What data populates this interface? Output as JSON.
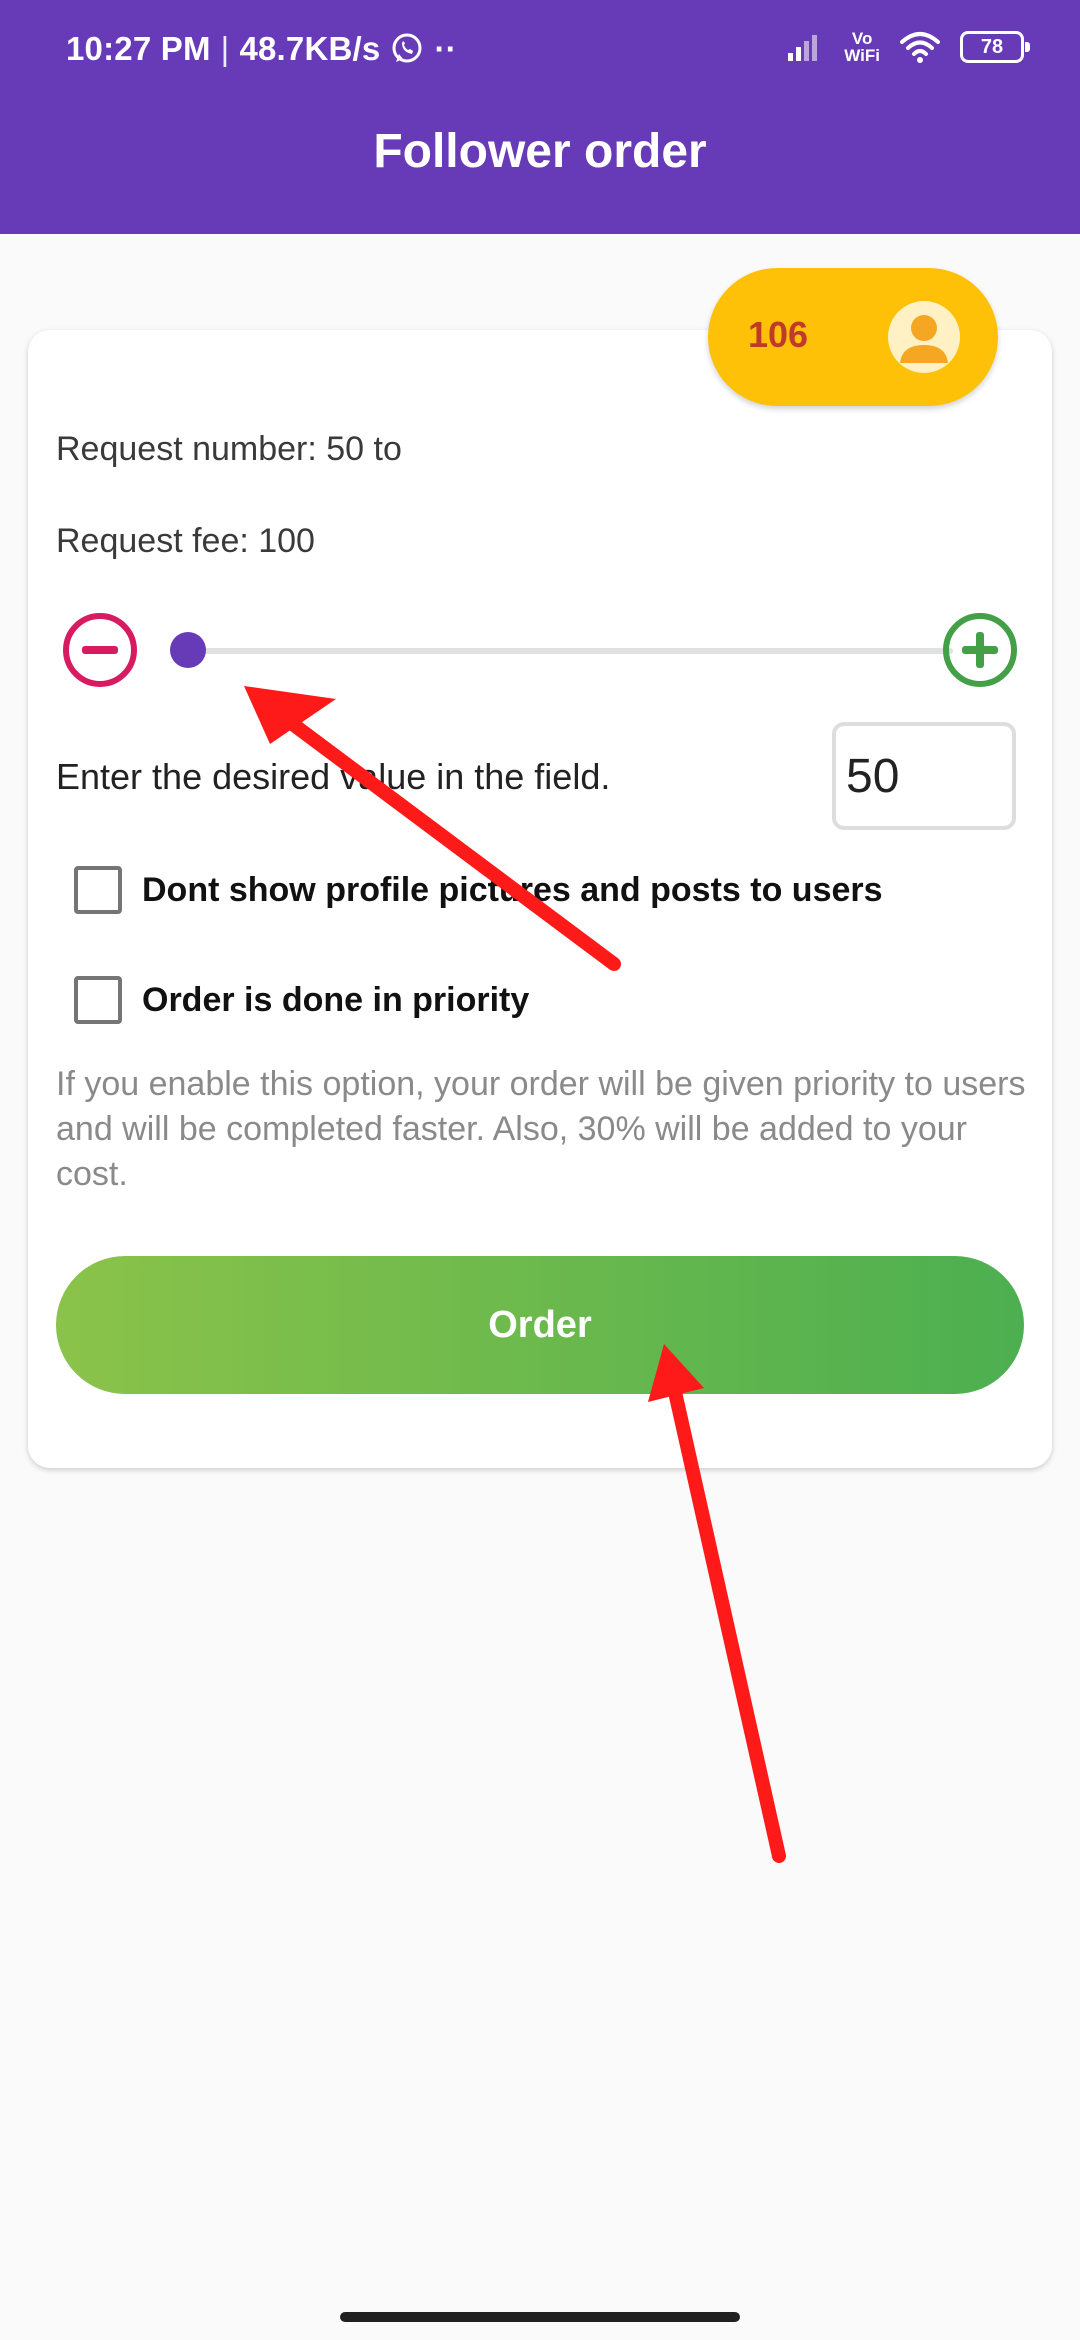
{
  "status_bar": {
    "time": "10:27 PM",
    "separator": "|",
    "speed": "48.7KB/s",
    "dots": "··",
    "vowifi_top": "Vo",
    "vowifi_bottom": "WiFi",
    "battery": "78"
  },
  "app_bar": {
    "title": "Follower order"
  },
  "coins": {
    "count": "106"
  },
  "order_form": {
    "request_number": "Request number: 50 to",
    "request_fee": "Request fee: 100",
    "slider_value": 0,
    "desired_label": "Enter the desired value in the field.",
    "value": "50",
    "option_hide_pictures": "Dont show profile pictures and posts to users",
    "option_priority": "Order is done in priority",
    "priority_hint": "If you enable this option, your order will be given priority to users and will be completed faster. Also, 30% will be added to your cost.",
    "order_button": "Order"
  },
  "icons": {
    "minus": "minus-circle-icon",
    "plus": "plus-circle-icon",
    "avatar": "user-avatar-icon",
    "whatsapp": "whatsapp-icon",
    "signal": "signal-icon",
    "wifi": "wifi-icon"
  },
  "colors": {
    "app_bar": "#673ab7",
    "coin_pill": "#ffc107",
    "coin_text": "#c0392b",
    "minus": "#d81b60",
    "plus": "#43a047",
    "slider_thumb": "#673ab7",
    "order_gradient_start": "#8bc34a",
    "order_gradient_end": "#4caf50",
    "annotation_arrow": "#ff1a1a"
  }
}
